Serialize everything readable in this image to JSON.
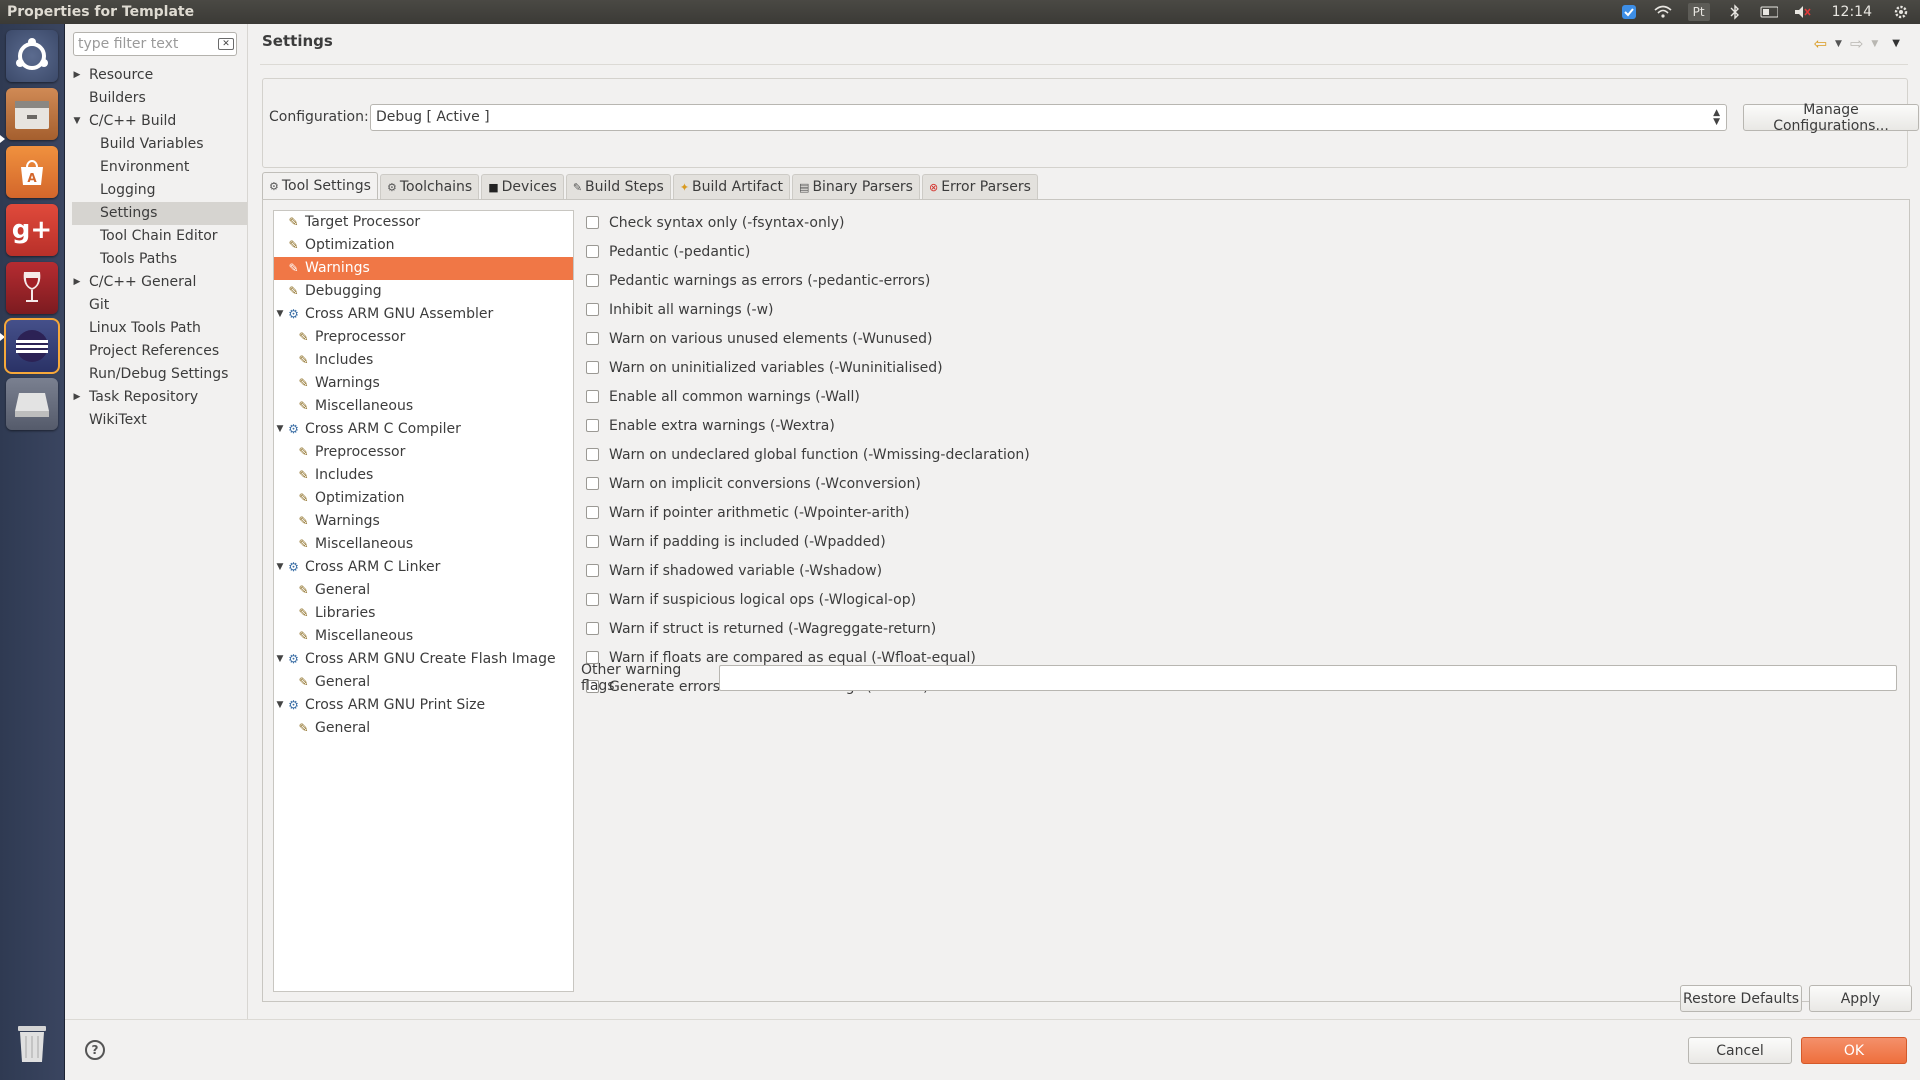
{
  "window": {
    "title": "Properties for Template"
  },
  "tray": {
    "clock": "12:14",
    "keyboard": "Pt"
  },
  "filter": {
    "placeholder": "type filter text"
  },
  "nav": {
    "items": [
      {
        "label": "Resource",
        "level": 0,
        "expandable": true,
        "expanded": false
      },
      {
        "label": "Builders",
        "level": 0,
        "expandable": false
      },
      {
        "label": "C/C++ Build",
        "level": 0,
        "expandable": true,
        "expanded": true
      },
      {
        "label": "Build Variables",
        "level": 1
      },
      {
        "label": "Environment",
        "level": 1
      },
      {
        "label": "Logging",
        "level": 1
      },
      {
        "label": "Settings",
        "level": 1,
        "selected": true
      },
      {
        "label": "Tool Chain Editor",
        "level": 1
      },
      {
        "label": "Tools Paths",
        "level": 1
      },
      {
        "label": "C/C++ General",
        "level": 0,
        "expandable": true,
        "expanded": false
      },
      {
        "label": "Git",
        "level": 0
      },
      {
        "label": "Linux Tools Path",
        "level": 0
      },
      {
        "label": "Project References",
        "level": 0
      },
      {
        "label": "Run/Debug Settings",
        "level": 0
      },
      {
        "label": "Task Repository",
        "level": 0,
        "expandable": true,
        "expanded": false
      },
      {
        "label": "WikiText",
        "level": 0
      }
    ]
  },
  "page": {
    "title": "Settings"
  },
  "config": {
    "label": "Configuration:",
    "value": "Debug  [ Active ]",
    "manage_label": "Manage Configurations..."
  },
  "tabs": [
    {
      "label": "Tool Settings",
      "icon": "gear-icon",
      "active": true
    },
    {
      "label": "Toolchains",
      "icon": "gear-icon"
    },
    {
      "label": "Devices",
      "icon": "chip-icon"
    },
    {
      "label": "Build Steps",
      "icon": "wrench-icon"
    },
    {
      "label": "Build Artifact",
      "icon": "artifact-icon"
    },
    {
      "label": "Binary Parsers",
      "icon": "binary-icon"
    },
    {
      "label": "Error Parsers",
      "icon": "error-icon"
    }
  ],
  "tool_tree": [
    {
      "label": "Target Processor",
      "level": 0,
      "type": "option"
    },
    {
      "label": "Optimization",
      "level": 0,
      "type": "option"
    },
    {
      "label": "Warnings",
      "level": 0,
      "type": "option",
      "selected": true
    },
    {
      "label": "Debugging",
      "level": 0,
      "type": "option"
    },
    {
      "label": "Cross ARM GNU Assembler",
      "level": 0,
      "type": "tool"
    },
    {
      "label": "Preprocessor",
      "level": 1,
      "type": "option"
    },
    {
      "label": "Includes",
      "level": 1,
      "type": "option"
    },
    {
      "label": "Warnings",
      "level": 1,
      "type": "option"
    },
    {
      "label": "Miscellaneous",
      "level": 1,
      "type": "option"
    },
    {
      "label": "Cross ARM C Compiler",
      "level": 0,
      "type": "tool"
    },
    {
      "label": "Preprocessor",
      "level": 1,
      "type": "option"
    },
    {
      "label": "Includes",
      "level": 1,
      "type": "option"
    },
    {
      "label": "Optimization",
      "level": 1,
      "type": "option"
    },
    {
      "label": "Warnings",
      "level": 1,
      "type": "option"
    },
    {
      "label": "Miscellaneous",
      "level": 1,
      "type": "option"
    },
    {
      "label": "Cross ARM C Linker",
      "level": 0,
      "type": "tool"
    },
    {
      "label": "General",
      "level": 1,
      "type": "option"
    },
    {
      "label": "Libraries",
      "level": 1,
      "type": "option"
    },
    {
      "label": "Miscellaneous",
      "level": 1,
      "type": "option"
    },
    {
      "label": "Cross ARM GNU Create Flash Image",
      "level": 0,
      "type": "tool"
    },
    {
      "label": "General",
      "level": 1,
      "type": "option"
    },
    {
      "label": "Cross ARM GNU Print Size",
      "level": 0,
      "type": "tool"
    },
    {
      "label": "General",
      "level": 1,
      "type": "option"
    }
  ],
  "warnings": [
    {
      "label": "Check syntax only (-fsyntax-only)",
      "checked": false
    },
    {
      "label": "Pedantic (-pedantic)",
      "checked": false
    },
    {
      "label": "Pedantic warnings as errors (-pedantic-errors)",
      "checked": false
    },
    {
      "label": "Inhibit all warnings (-w)",
      "checked": false
    },
    {
      "label": "Warn on various unused elements (-Wunused)",
      "checked": false
    },
    {
      "label": "Warn on uninitialized variables (-Wuninitialised)",
      "checked": false
    },
    {
      "label": "Enable all common warnings (-Wall)",
      "checked": false
    },
    {
      "label": "Enable extra warnings (-Wextra)",
      "checked": false
    },
    {
      "label": "Warn on undeclared global function (-Wmissing-declaration)",
      "checked": false
    },
    {
      "label": "Warn on implicit conversions (-Wconversion)",
      "checked": false
    },
    {
      "label": "Warn if pointer arithmetic (-Wpointer-arith)",
      "checked": false
    },
    {
      "label": "Warn if padding is included (-Wpadded)",
      "checked": false
    },
    {
      "label": "Warn if shadowed variable (-Wshadow)",
      "checked": false
    },
    {
      "label": "Warn if suspicious logical ops (-Wlogical-op)",
      "checked": false
    },
    {
      "label": "Warn if struct is returned (-Wagreggate-return)",
      "checked": false
    },
    {
      "label": "Warn if floats are compared as equal (-Wfloat-equal)",
      "checked": false
    },
    {
      "label": "Generate errors instead of warnings (-Werror)",
      "checked": false
    }
  ],
  "other_flags": {
    "label": "Other warning flags",
    "value": ""
  },
  "buttons": {
    "restore": "Restore Defaults",
    "apply": "Apply",
    "cancel": "Cancel",
    "ok": "OK"
  },
  "colors": {
    "selection": "#f07746",
    "ok_button": "#ee6f3d",
    "launcher": "#2f3a52"
  }
}
